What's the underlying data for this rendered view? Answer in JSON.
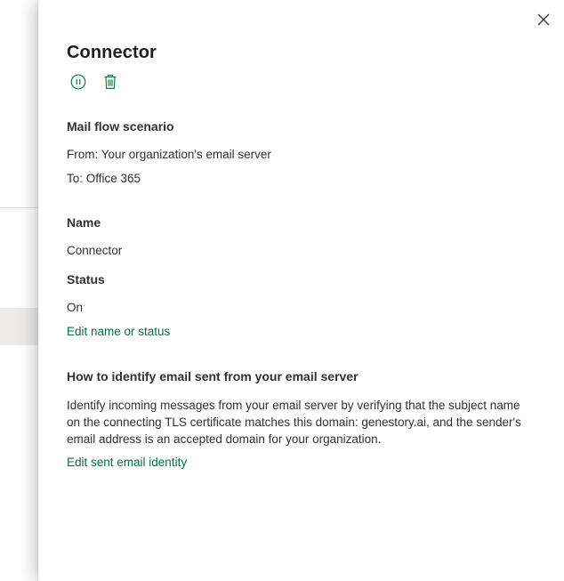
{
  "panel": {
    "title": "Connector",
    "close_icon": "close-icon",
    "actions": [
      {
        "name": "pause",
        "icon": "pause-circle-icon"
      },
      {
        "name": "delete",
        "icon": "trash-icon"
      }
    ]
  },
  "mail_flow": {
    "heading": "Mail flow scenario",
    "from": "From: Your organization's email server",
    "to": "To: Office 365"
  },
  "name_section": {
    "heading": "Name",
    "value": "Connector"
  },
  "status_section": {
    "heading": "Status",
    "value": "On",
    "edit_link": "Edit name or status"
  },
  "identify_section": {
    "heading": "How to identify email sent from your email server",
    "description": "Identify incoming messages from your email server by verifying that the subject name on the connecting TLS certificate matches this domain: genestory.ai, and the sender's email address is an accepted domain for your organization.",
    "edit_link": "Edit sent email identity"
  },
  "colors": {
    "accent": "#0b6a4a",
    "text": "#323130",
    "icon": "#107c41"
  }
}
